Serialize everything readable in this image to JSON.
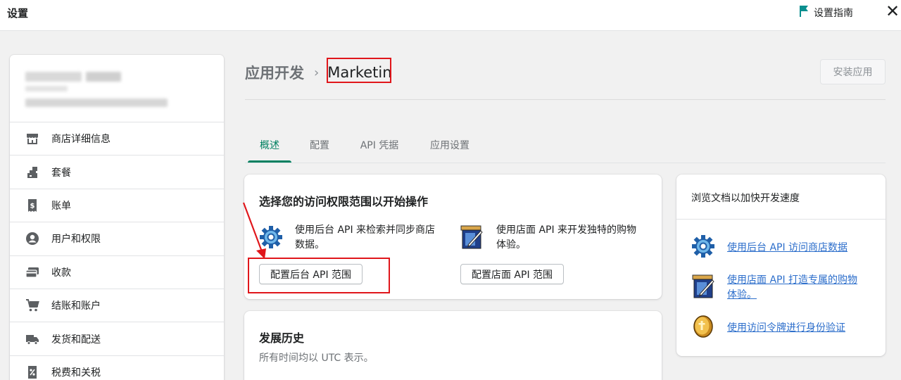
{
  "topbar": {
    "title": "设置",
    "guide_label": "设置指南",
    "close_glyph": "✕",
    "flag_color": "#0a8f8f"
  },
  "sidebar": {
    "items": [
      {
        "label": "商店详细信息",
        "icon": "store-icon"
      },
      {
        "label": "套餐",
        "icon": "plan-icon"
      },
      {
        "label": "账单",
        "icon": "billing-icon"
      },
      {
        "label": "用户和权限",
        "icon": "user-icon"
      },
      {
        "label": "收款",
        "icon": "payments-icon"
      },
      {
        "label": "结账和账户",
        "icon": "cart-icon"
      },
      {
        "label": "发货和配送",
        "icon": "truck-icon"
      },
      {
        "label": "税费和关税",
        "icon": "tax-icon"
      }
    ]
  },
  "breadcrumb": {
    "parent": "应用开发",
    "separator": "›",
    "current": "Marketin"
  },
  "install_button": "安装应用",
  "tabs": [
    {
      "label": "概述",
      "active": true
    },
    {
      "label": "配置",
      "active": false
    },
    {
      "label": "API 凭据",
      "active": false
    },
    {
      "label": "应用设置",
      "active": false
    }
  ],
  "scopes_card": {
    "title": "选择您的访问权限范围以开始操作",
    "admin": {
      "text_line1": "使用后台 API 来检索并同步商店",
      "text_line2": "数据。",
      "button": "配置后台 API 范围"
    },
    "storefront": {
      "text_line1": "使用店面 API 来开发独特的购物",
      "text_line2": "体验。",
      "button": "配置店面 API 范围"
    }
  },
  "history_card": {
    "title": "发展历史",
    "subtitle": "所有时间均以 UTC 表示。"
  },
  "docs_card": {
    "title": "浏览文档以加快开发速度",
    "links": [
      {
        "line1": "使用后台 API 访问商店数据",
        "line2": ""
      },
      {
        "line1": "使用店面 API 打造专属的购物",
        "line2": "体验。"
      },
      {
        "line1": "使用访问令牌进行身份验证",
        "line2": ""
      }
    ]
  },
  "colors": {
    "accent": "#008060",
    "highlight": "#e0161b",
    "link": "#2c6ecb"
  }
}
